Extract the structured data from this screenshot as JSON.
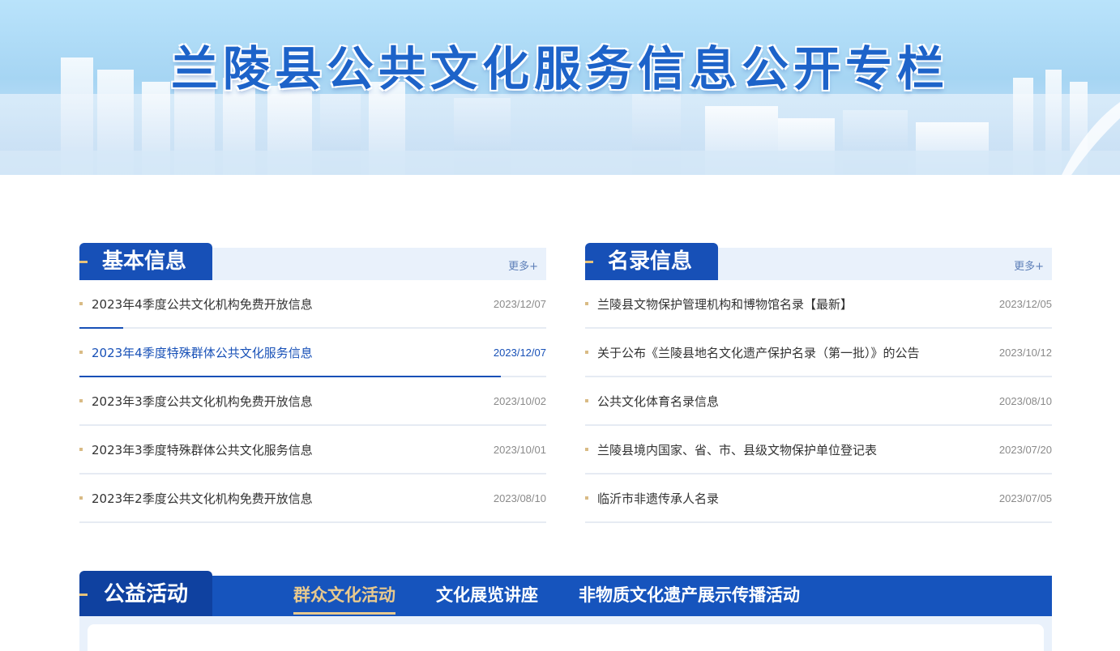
{
  "banner": {
    "title": "兰陵县公共文化服务信息公开专栏"
  },
  "basic_info": {
    "title": "基本信息",
    "more": "更多+",
    "items": [
      {
        "title": "2023年4季度公共文化机构免费开放信息",
        "date": "2023/12/07"
      },
      {
        "title": "2023年4季度特殊群体公共文化服务信息",
        "date": "2023/12/07"
      },
      {
        "title": "2023年3季度公共文化机构免费开放信息",
        "date": "2023/10/02"
      },
      {
        "title": "2023年3季度特殊群体公共文化服务信息",
        "date": "2023/10/01"
      },
      {
        "title": "2023年2季度公共文化机构免费开放信息",
        "date": "2023/08/10"
      }
    ]
  },
  "directory_info": {
    "title": "名录信息",
    "more": "更多+",
    "items": [
      {
        "title": "兰陵县文物保护管理机构和博物馆名录【最新】",
        "date": "2023/12/05"
      },
      {
        "title": "关于公布《兰陵县地名文化遗产保护名录（第一批）》的公告",
        "date": "2023/10/12"
      },
      {
        "title": "公共文化体育名录信息",
        "date": "2023/08/10"
      },
      {
        "title": "兰陵县境内国家、省、市、县级文物保护单位登记表",
        "date": "2023/07/20"
      },
      {
        "title": "临沂市非遗传承人名录",
        "date": "2023/07/05"
      }
    ]
  },
  "activities": {
    "title": "公益活动",
    "tabs": [
      "群众文化活动",
      "文化展览讲座",
      "非物质文化遗产展示传播活动"
    ],
    "selected_tab": "群众文化活动"
  },
  "colors": {
    "primary": "#1750b7",
    "accent_gold": "#e8c98e",
    "banner_title": "#1d63c9"
  }
}
